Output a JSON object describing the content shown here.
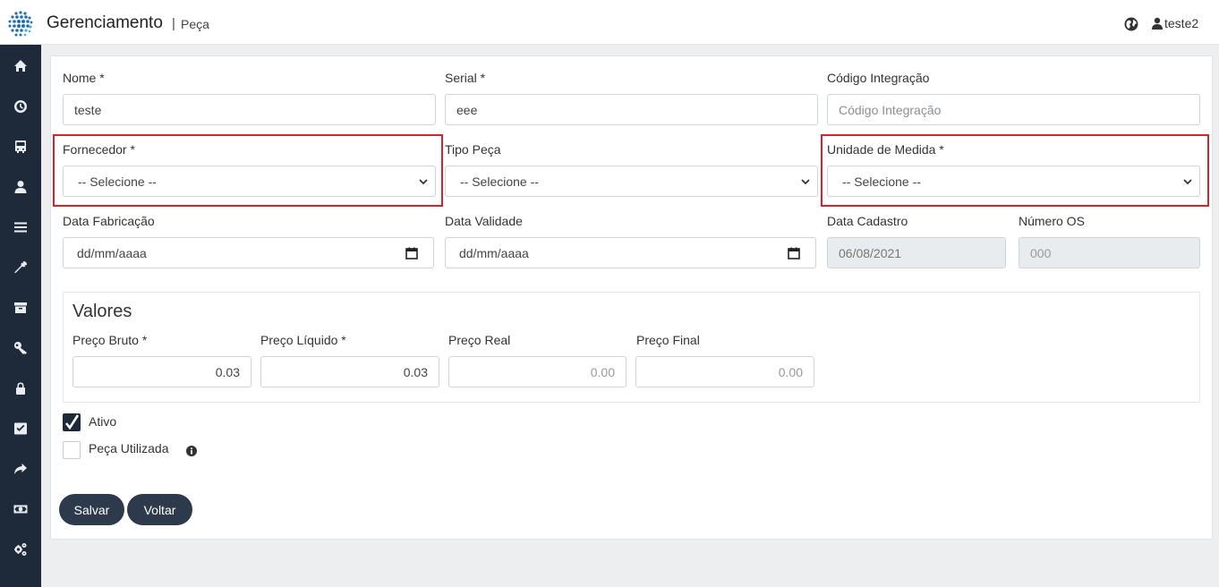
{
  "header": {
    "app_title": "Gerenciamento",
    "separator": "|",
    "page": "Peça",
    "user": "teste2",
    "icons": [
      "globe-icon",
      "user-icon"
    ]
  },
  "sidebar": {
    "items": [
      {
        "icon": "home-icon"
      },
      {
        "icon": "clock-icon"
      },
      {
        "icon": "bus-icon"
      },
      {
        "icon": "user-icon"
      },
      {
        "icon": "list-icon"
      },
      {
        "icon": "wrench-icon"
      },
      {
        "icon": "archive-icon"
      },
      {
        "icon": "key-icon"
      },
      {
        "icon": "lock-icon"
      },
      {
        "icon": "check-square-icon"
      },
      {
        "icon": "share-icon"
      },
      {
        "icon": "money-icon"
      },
      {
        "icon": "cogs-icon"
      }
    ]
  },
  "form": {
    "nome": {
      "label": "Nome *",
      "value": "teste"
    },
    "serial": {
      "label": "Serial *",
      "value": "eee"
    },
    "codigo_integracao": {
      "label": "Código Integração",
      "placeholder": "Código Integração"
    },
    "fornecedor": {
      "label": "Fornecedor *",
      "selected": "-- Selecione --"
    },
    "tipo_peca": {
      "label": "Tipo Peça",
      "selected": "-- Selecione --"
    },
    "unidade_medida": {
      "label": "Unidade de Medida *",
      "selected": "-- Selecione --"
    },
    "data_fabricacao": {
      "label": "Data Fabricação",
      "placeholder": "dd/mm/aaaa"
    },
    "data_validade": {
      "label": "Data Validade",
      "placeholder": "dd/mm/aaaa"
    },
    "data_cadastro": {
      "label": "Data Cadastro",
      "value": "06/08/2021"
    },
    "numero_os": {
      "label": "Número OS",
      "placeholder": "000"
    }
  },
  "valores": {
    "title": "Valores",
    "preco_bruto": {
      "label": "Preço Bruto *",
      "value": "0.03"
    },
    "preco_liquido": {
      "label": "Preço Líquido *",
      "value": "0.03"
    },
    "preco_real": {
      "label": "Preço Real",
      "value": "0.00"
    },
    "preco_final": {
      "label": "Preço Final",
      "value": "0.00"
    }
  },
  "checks": {
    "ativo": {
      "label": "Ativo",
      "checked": true
    },
    "peca_utilizada": {
      "label": "Peça Utilizada",
      "checked": false
    }
  },
  "buttons": {
    "salvar": "Salvar",
    "voltar": "Voltar"
  },
  "colors": {
    "sidebar": "#1e2a3a",
    "button": "#2c3a4b",
    "highlight": "#d8232a"
  }
}
